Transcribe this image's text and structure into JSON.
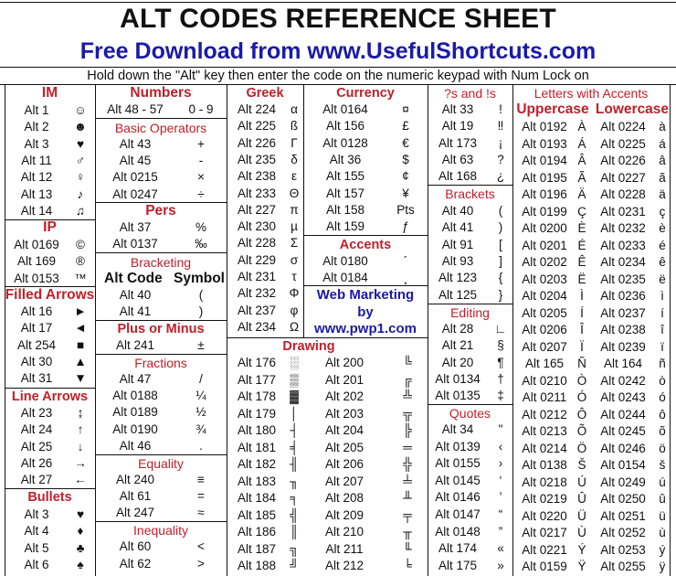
{
  "header": {
    "title": "ALT CODES REFERENCE SHEET",
    "subtitle": "Free Download from www.UsefulShortcuts.com",
    "instruction": "Hold down the \"Alt\" key then enter the code on the numeric keypad with Num Lock on"
  },
  "col1": {
    "im": {
      "title": "IM",
      "rows": [
        {
          "code": "Alt 1",
          "sym": "☺"
        },
        {
          "code": "Alt 2",
          "sym": "☻"
        },
        {
          "code": "Alt 3",
          "sym": "♥"
        },
        {
          "code": "Alt 11",
          "sym": "♂"
        },
        {
          "code": "Alt 12",
          "sym": "♀"
        },
        {
          "code": "Alt 13",
          "sym": "♪"
        },
        {
          "code": "Alt 14",
          "sym": "♫"
        }
      ]
    },
    "ip": {
      "title": "IP",
      "rows": [
        {
          "code": "Alt 0169",
          "sym": "©"
        },
        {
          "code": "Alt 169",
          "sym": "®"
        },
        {
          "code": "Alt 0153",
          "sym": "™"
        }
      ]
    },
    "filled_arrows": {
      "title": "Filled Arrows",
      "rows": [
        {
          "code": "Alt 16",
          "sym": "►"
        },
        {
          "code": "Alt 17",
          "sym": "◄"
        },
        {
          "code": "Alt 254",
          "sym": "■"
        },
        {
          "code": "Alt 30",
          "sym": "▲"
        },
        {
          "code": "Alt 31",
          "sym": "▼"
        }
      ]
    },
    "line_arrows": {
      "title": "Line Arrows",
      "rows": [
        {
          "code": "Alt 23",
          "sym": "↨"
        },
        {
          "code": "Alt 24",
          "sym": "↑"
        },
        {
          "code": "Alt 25",
          "sym": "↓"
        },
        {
          "code": "Alt 26",
          "sym": "→"
        },
        {
          "code": "Alt 27",
          "sym": "←"
        }
      ]
    },
    "bullets": {
      "title": "Bullets",
      "rows": [
        {
          "code": "Alt 3",
          "sym": "♥"
        },
        {
          "code": "Alt 4",
          "sym": "♦"
        },
        {
          "code": "Alt 5",
          "sym": "♣"
        },
        {
          "code": "Alt 6",
          "sym": "♠"
        }
      ]
    }
  },
  "col2": {
    "numbers": {
      "title": "Numbers",
      "rows": [
        {
          "code": "Alt 48 - 57",
          "sym": "0 - 9"
        }
      ]
    },
    "basic_operators": {
      "title": "Basic Operators",
      "rows": [
        {
          "code": "Alt 43",
          "sym": "+"
        },
        {
          "code": "Alt 45",
          "sym": "-"
        },
        {
          "code": "Alt 0215",
          "sym": "×"
        },
        {
          "code": "Alt 0247",
          "sym": "÷"
        }
      ]
    },
    "pers": {
      "title": "Pers",
      "rows": [
        {
          "code": "Alt 37",
          "sym": "%"
        },
        {
          "code": "Alt 0137",
          "sym": "‰"
        }
      ]
    },
    "bracketing": {
      "title": "Bracketing",
      "header_code": "Alt Code",
      "header_symbol": "Symbol",
      "rows": [
        {
          "code": "Alt 40",
          "sym": "("
        },
        {
          "code": "Alt 41",
          "sym": ")"
        }
      ]
    },
    "plus_minus": {
      "title": "Plus or Minus",
      "rows": [
        {
          "code": "Alt 241",
          "sym": "±"
        }
      ]
    },
    "fractions": {
      "title": "Fractions",
      "rows": [
        {
          "code": "Alt 47",
          "sym": "/"
        },
        {
          "code": "Alt 0188",
          "sym": "¼"
        },
        {
          "code": "Alt 0189",
          "sym": "½"
        },
        {
          "code": "Alt 0190",
          "sym": "¾"
        },
        {
          "code": "Alt 46",
          "sym": "."
        }
      ]
    },
    "equality": {
      "title": "Equality",
      "rows": [
        {
          "code": "Alt 240",
          "sym": "≡"
        },
        {
          "code": "Alt 61",
          "sym": "="
        },
        {
          "code": "Alt 247",
          "sym": "≈"
        }
      ]
    },
    "inequality": {
      "title": "Inequality",
      "rows": [
        {
          "code": "Alt 60",
          "sym": "<"
        },
        {
          "code": "Alt 62",
          "sym": ">"
        }
      ]
    }
  },
  "col3": {
    "greek": {
      "title": "Greek",
      "rows": [
        {
          "code": "Alt 224",
          "sym": "α"
        },
        {
          "code": "Alt 225",
          "sym": "ß"
        },
        {
          "code": "Alt 226",
          "sym": "Γ"
        },
        {
          "code": "Alt 235",
          "sym": "δ"
        },
        {
          "code": "Alt 238",
          "sym": "ε"
        },
        {
          "code": "Alt 233",
          "sym": "Θ"
        },
        {
          "code": "Alt 227",
          "sym": "π"
        },
        {
          "code": "Alt 230",
          "sym": "µ"
        },
        {
          "code": "Alt 228",
          "sym": "Σ"
        },
        {
          "code": "Alt 229",
          "sym": "σ"
        },
        {
          "code": "Alt 231",
          "sym": "τ"
        },
        {
          "code": "Alt 232",
          "sym": "Φ"
        },
        {
          "code": "Alt 237",
          "sym": "φ"
        },
        {
          "code": "Alt 234",
          "sym": "Ω"
        }
      ]
    },
    "currency": {
      "title": "Currency",
      "rows": [
        {
          "code": "Alt 0164",
          "sym": "¤"
        },
        {
          "code": "Alt 156",
          "sym": "£"
        },
        {
          "code": "Alt 0128",
          "sym": "€"
        },
        {
          "code": "Alt 36",
          "sym": "$"
        },
        {
          "code": "Alt 155",
          "sym": "¢"
        },
        {
          "code": "Alt 157",
          "sym": "¥"
        },
        {
          "code": "Alt 158",
          "sym": "Pts"
        },
        {
          "code": "Alt 159",
          "sym": "ƒ"
        }
      ]
    },
    "accents": {
      "title": "Accents",
      "rows": [
        {
          "code": "Alt 0180",
          "sym": "´"
        },
        {
          "code": "Alt 0184",
          "sym": "¸"
        }
      ]
    },
    "web_marketing": {
      "line1": "Web Marketing",
      "line2": "by",
      "line3": "www.pwp1.com"
    },
    "drawing": {
      "title": "Drawing",
      "left": [
        {
          "code": "Alt 176",
          "sym": "░"
        },
        {
          "code": "Alt 177",
          "sym": "▒"
        },
        {
          "code": "Alt 178",
          "sym": "▓"
        },
        {
          "code": "Alt 179",
          "sym": "│"
        },
        {
          "code": "Alt 180",
          "sym": "┤"
        },
        {
          "code": "Alt 181",
          "sym": "╡"
        },
        {
          "code": "Alt 182",
          "sym": "╢"
        },
        {
          "code": "Alt 183",
          "sym": "╖"
        },
        {
          "code": "Alt 184",
          "sym": "╕"
        },
        {
          "code": "Alt 185",
          "sym": "╣"
        },
        {
          "code": "Alt 186",
          "sym": "║"
        },
        {
          "code": "Alt 187",
          "sym": "╗"
        },
        {
          "code": "Alt 188",
          "sym": "╝"
        }
      ],
      "right": [
        {
          "code": "Alt 200",
          "sym": "╚"
        },
        {
          "code": "Alt 201",
          "sym": "╔"
        },
        {
          "code": "Alt 202",
          "sym": "╩"
        },
        {
          "code": "Alt 203",
          "sym": "╦"
        },
        {
          "code": "Alt 204",
          "sym": "╠"
        },
        {
          "code": "Alt 205",
          "sym": "═"
        },
        {
          "code": "Alt 206",
          "sym": "╬"
        },
        {
          "code": "Alt 207",
          "sym": "╧"
        },
        {
          "code": "Alt 208",
          "sym": "╨"
        },
        {
          "code": "Alt 209",
          "sym": "╤"
        },
        {
          "code": "Alt 210",
          "sym": "╥"
        },
        {
          "code": "Alt 211",
          "sym": "╙"
        },
        {
          "code": "Alt 212",
          "sym": "╘"
        }
      ]
    }
  },
  "col4": {
    "qs_and_exs": {
      "title": "?s and !s",
      "rows": [
        {
          "code": "Alt 33",
          "sym": "!"
        },
        {
          "code": "Alt 19",
          "sym": "‼"
        },
        {
          "code": "Alt 173",
          "sym": "¡"
        },
        {
          "code": "Alt 63",
          "sym": "?"
        },
        {
          "code": "Alt 168",
          "sym": "¿"
        }
      ]
    },
    "brackets": {
      "title": "Brackets",
      "rows": [
        {
          "code": "Alt 40",
          "sym": "("
        },
        {
          "code": "Alt 41",
          "sym": ")"
        },
        {
          "code": "Alt 91",
          "sym": "["
        },
        {
          "code": "Alt 93",
          "sym": "]"
        },
        {
          "code": "Alt 123",
          "sym": "{"
        },
        {
          "code": "Alt 125",
          "sym": "}"
        }
      ]
    },
    "editing": {
      "title": "Editing",
      "rows": [
        {
          "code": "Alt 28",
          "sym": "∟"
        },
        {
          "code": "Alt 21",
          "sym": "§"
        },
        {
          "code": "Alt 20",
          "sym": "¶"
        },
        {
          "code": "Alt 0134",
          "sym": "†"
        },
        {
          "code": "Alt 0135",
          "sym": "‡"
        }
      ]
    },
    "quotes": {
      "title": "Quotes",
      "rows": [
        {
          "code": "Alt 34",
          "sym": "\""
        },
        {
          "code": "Alt 0139",
          "sym": "‹"
        },
        {
          "code": "Alt 0155",
          "sym": "›"
        },
        {
          "code": "Alt 0145",
          "sym": "‘"
        },
        {
          "code": "Alt 0146",
          "sym": "’"
        },
        {
          "code": "Alt 0147",
          "sym": "“"
        },
        {
          "code": "Alt 0148",
          "sym": "”"
        },
        {
          "code": "Alt 174",
          "sym": "«"
        },
        {
          "code": "Alt 175",
          "sym": "»"
        }
      ]
    }
  },
  "col5": {
    "title": "Letters with Accents",
    "upper_header": "Uppercase",
    "lower_header": "Lowercase",
    "rows": [
      {
        "ucode": "Alt 0192",
        "usym": "À",
        "lcode": "Alt 0224",
        "lsym": "à"
      },
      {
        "ucode": "Alt 0193",
        "usym": "Á",
        "lcode": "Alt 0225",
        "lsym": "á"
      },
      {
        "ucode": "Alt 0194",
        "usym": "Â",
        "lcode": "Alt 0226",
        "lsym": "â"
      },
      {
        "ucode": "Alt 0195",
        "usym": "Ã",
        "lcode": "Alt 0227",
        "lsym": "ã"
      },
      {
        "ucode": "Alt 0196",
        "usym": "Ä",
        "lcode": "Alt 0228",
        "lsym": "ä"
      },
      {
        "ucode": "Alt 0199",
        "usym": "Ç",
        "lcode": "Alt 0231",
        "lsym": "ç"
      },
      {
        "ucode": "Alt 0200",
        "usym": "È",
        "lcode": "Alt 0232",
        "lsym": "è"
      },
      {
        "ucode": "Alt 0201",
        "usym": "É",
        "lcode": "Alt 0233",
        "lsym": "é"
      },
      {
        "ucode": "Alt 0202",
        "usym": "Ê",
        "lcode": "Alt 0234",
        "lsym": "ê"
      },
      {
        "ucode": "Alt 0203",
        "usym": "Ë",
        "lcode": "Alt 0235",
        "lsym": "ë"
      },
      {
        "ucode": "Alt 0204",
        "usym": "Ì",
        "lcode": "Alt 0236",
        "lsym": "ì"
      },
      {
        "ucode": "Alt 0205",
        "usym": "Í",
        "lcode": "Alt 0237",
        "lsym": "í"
      },
      {
        "ucode": "Alt 0206",
        "usym": "Î",
        "lcode": "Alt 0238",
        "lsym": "î"
      },
      {
        "ucode": "Alt 0207",
        "usym": "Ï",
        "lcode": "Alt 0239",
        "lsym": "ï"
      },
      {
        "ucode": "Alt 165",
        "usym": "Ñ",
        "lcode": "Alt 164",
        "lsym": "ñ"
      },
      {
        "ucode": "Alt 0210",
        "usym": "Ò",
        "lcode": "Alt 0242",
        "lsym": "ò"
      },
      {
        "ucode": "Alt 0211",
        "usym": "Ó",
        "lcode": "Alt 0243",
        "lsym": "ó"
      },
      {
        "ucode": "Alt 0212",
        "usym": "Ô",
        "lcode": "Alt 0244",
        "lsym": "ô"
      },
      {
        "ucode": "Alt 0213",
        "usym": "Õ",
        "lcode": "Alt 0245",
        "lsym": "õ"
      },
      {
        "ucode": "Alt 0214",
        "usym": "Ö",
        "lcode": "Alt 0246",
        "lsym": "ö"
      },
      {
        "ucode": "Alt 0138",
        "usym": "Š",
        "lcode": "Alt 0154",
        "lsym": "š"
      },
      {
        "ucode": "Alt 0218",
        "usym": "Ú",
        "lcode": "Alt 0249",
        "lsym": "ú"
      },
      {
        "ucode": "Alt 0219",
        "usym": "Û",
        "lcode": "Alt 0250",
        "lsym": "û"
      },
      {
        "ucode": "Alt 0220",
        "usym": "Ü",
        "lcode": "Alt 0251",
        "lsym": "ü"
      },
      {
        "ucode": "Alt 0217",
        "usym": "Ù",
        "lcode": "Alt 0252",
        "lsym": "ù"
      },
      {
        "ucode": "Alt 0221",
        "usym": "Ý",
        "lcode": "Alt 0253",
        "lsym": "ý"
      },
      {
        "ucode": "Alt 0159",
        "usym": "Ÿ",
        "lcode": "Alt 0255",
        "lsym": "ÿ"
      }
    ]
  },
  "colors": {
    "section_title": "#c0202a",
    "brand_blue": "#1a1aa8",
    "text": "#111111",
    "border": "#111111"
  }
}
